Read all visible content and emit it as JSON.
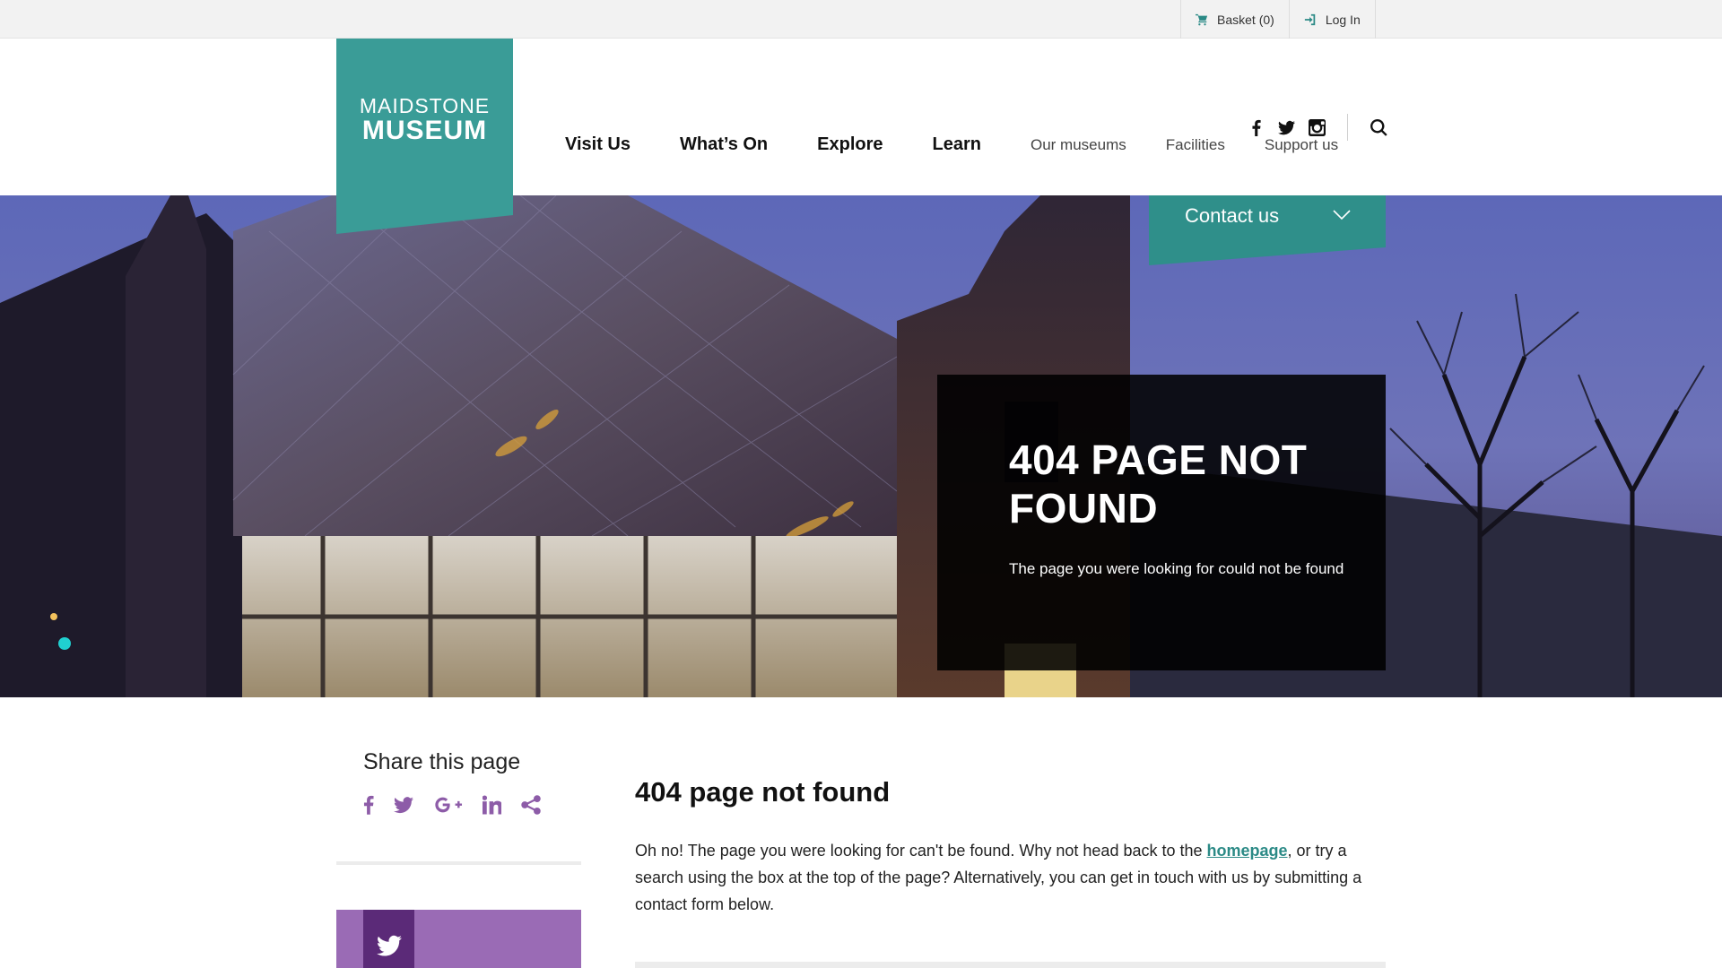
{
  "utility": {
    "basket_label": "Basket (0)",
    "login_label": "Log In"
  },
  "brand": {
    "line1": "MAIDSTONE",
    "line2": "MUSEUM",
    "color": "#3a9c97"
  },
  "nav": {
    "primary": [
      "Visit Us",
      "What’s On",
      "Explore",
      "Learn"
    ],
    "secondary": [
      "Our museums",
      "Facilities",
      "Support us"
    ]
  },
  "social_header": [
    "facebook-icon",
    "twitter-icon",
    "instagram-icon",
    "search-icon"
  ],
  "contact": {
    "label": "Contact us"
  },
  "hero": {
    "title": "404 PAGE NOT FOUND",
    "subtitle": "The page you were looking for could not be found"
  },
  "sidebar": {
    "share_title": "Share this page",
    "share_icons": [
      "facebook-icon",
      "twitter-icon",
      "google-plus-icon",
      "linkedin-icon",
      "share-icon"
    ],
    "accent": "#8d5ca8"
  },
  "content": {
    "title": "404 page not found",
    "body_before": "Oh no! The page you were looking for can't be found. Why not head back to the ",
    "link_text": "homepage",
    "body_after": ", or try a search using the box at the top of the page? Alternatively, you can get in touch with us by submitting a contact form below."
  }
}
